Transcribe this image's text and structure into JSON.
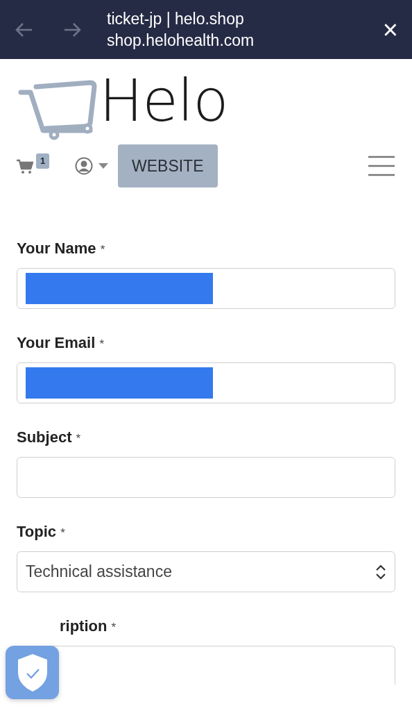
{
  "browser_bar": {
    "title": "ticket-jp | helo.shop",
    "url": "shop.helohealth.com",
    "close": "×"
  },
  "logo": {
    "text": "Helo"
  },
  "nav": {
    "cart_count": "1",
    "button": "WEBSITE"
  },
  "fields": [
    {
      "kind": "text",
      "label": "Your Name",
      "required": "*",
      "redacted": true
    },
    {
      "kind": "text",
      "label": "Your Email",
      "required": "*",
      "redacted": true
    },
    {
      "kind": "text",
      "label": "Subject",
      "required": "*",
      "redacted": false
    },
    {
      "kind": "select",
      "label": "Topic",
      "required": "*",
      "value": "Technical assistance"
    },
    {
      "kind": "textarea",
      "label": "ription",
      "required": "*",
      "covered": true
    }
  ]
}
